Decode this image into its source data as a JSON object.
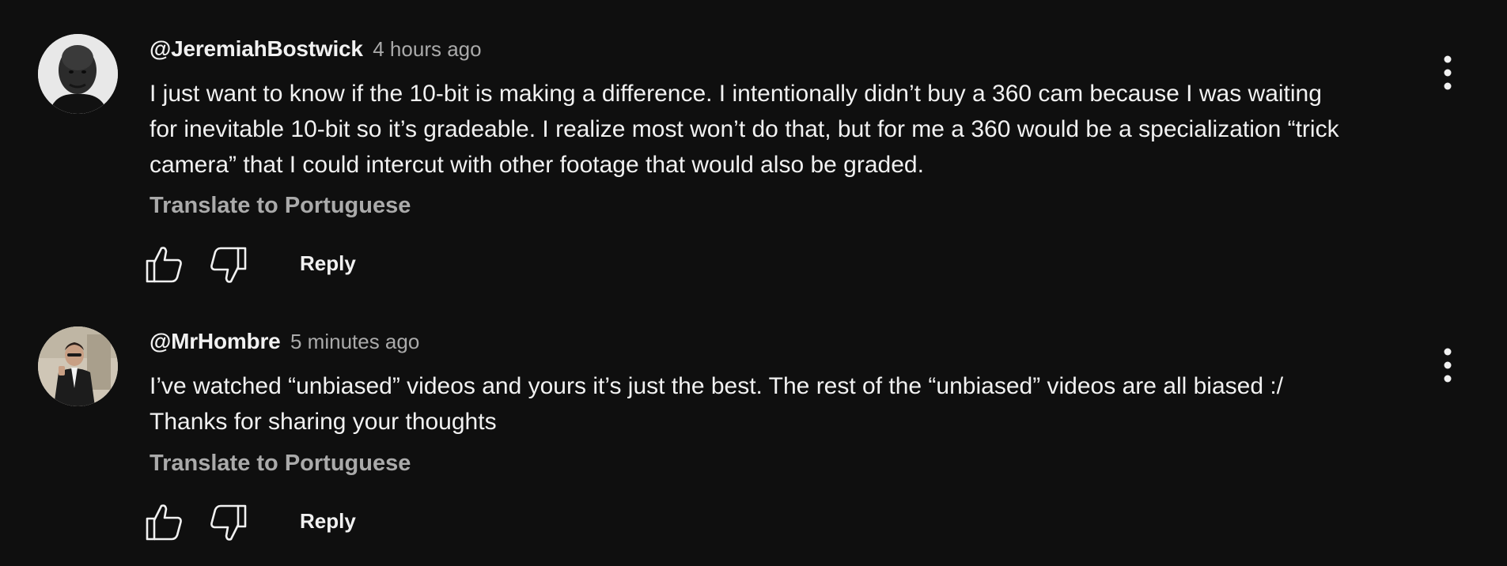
{
  "comments": [
    {
      "author": "@JeremiahBostwick",
      "time": "4 hours ago",
      "body_lines": [
        "I just want to know if the 10-bit is making a difference. I intentionally didn’t buy a 360 cam because I was waiting",
        "for inevitable 10-bit so it’s gradeable. I realize most won’t do that, but for me a 360 would be a specialization “trick",
        "camera” that I could intercut with other footage that would also be graded."
      ],
      "translate_label": "Translate to Portuguese",
      "reply_label": "Reply",
      "avatar_icon": "avatar-bald-man-icon"
    },
    {
      "author": "@MrHombre",
      "time": "5 minutes ago",
      "body_lines": [
        "I’ve watched “unbiased” videos and yours it’s just the best. The rest of  the “unbiased” videos are all biased :/",
        "Thanks for sharing your thoughts"
      ],
      "translate_label": "Translate to Portuguese",
      "reply_label": "Reply",
      "avatar_icon": "avatar-man-in-suit-icon"
    }
  ],
  "icons": {
    "like": "thumbs-up-icon",
    "dislike": "thumbs-down-icon",
    "more": "more-vert-icon"
  },
  "colors": {
    "background": "#0f0f0f",
    "primary_text": "#f1f1f1",
    "secondary_text": "#aaaaaa"
  }
}
